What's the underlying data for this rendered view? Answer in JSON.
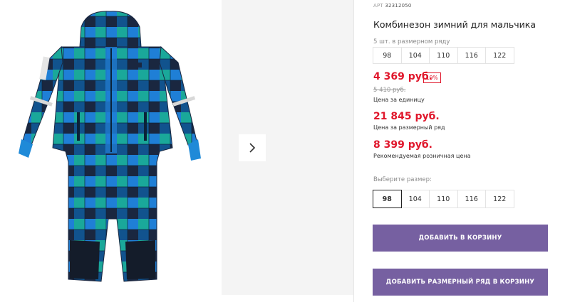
{
  "product": {
    "article_label": "АРТ",
    "article_number": "32312050",
    "title": "Комбинезон зимний для мальчика"
  },
  "size_row": {
    "caption": "5 шт. в размерном ряду",
    "sizes": [
      "98",
      "104",
      "110",
      "116",
      "122"
    ]
  },
  "prices": {
    "unit_price": "4 369 руб.",
    "discount": "19%",
    "old_price": "5 410 руб.",
    "unit_caption": "Цена за единицу",
    "row_price": "21 845 руб.",
    "row_caption": "Цена за размерный ряд",
    "rrp_price": "8 399 руб.",
    "rrp_caption": "Рекомендуемая розничная цена"
  },
  "size_select": {
    "caption": "Выберите размер:",
    "sizes": [
      "98",
      "104",
      "110",
      "116",
      "122"
    ],
    "selected": "98"
  },
  "buttons": {
    "add_to_cart": "ДОБАВИТЬ В КОРЗИНУ",
    "add_row_to_cart": "ДОБАВИТЬ РАЗМЕРНЫЙ РЯД В КОРЗИНУ"
  },
  "icons": {
    "next": "chevron-right-icon"
  },
  "colors": {
    "price_red": "#e0162b",
    "button_purple": "#7660a1",
    "plaid_blue": "#1f7fd6",
    "plaid_teal": "#1aa89a",
    "plaid_navy": "#1a2740"
  }
}
